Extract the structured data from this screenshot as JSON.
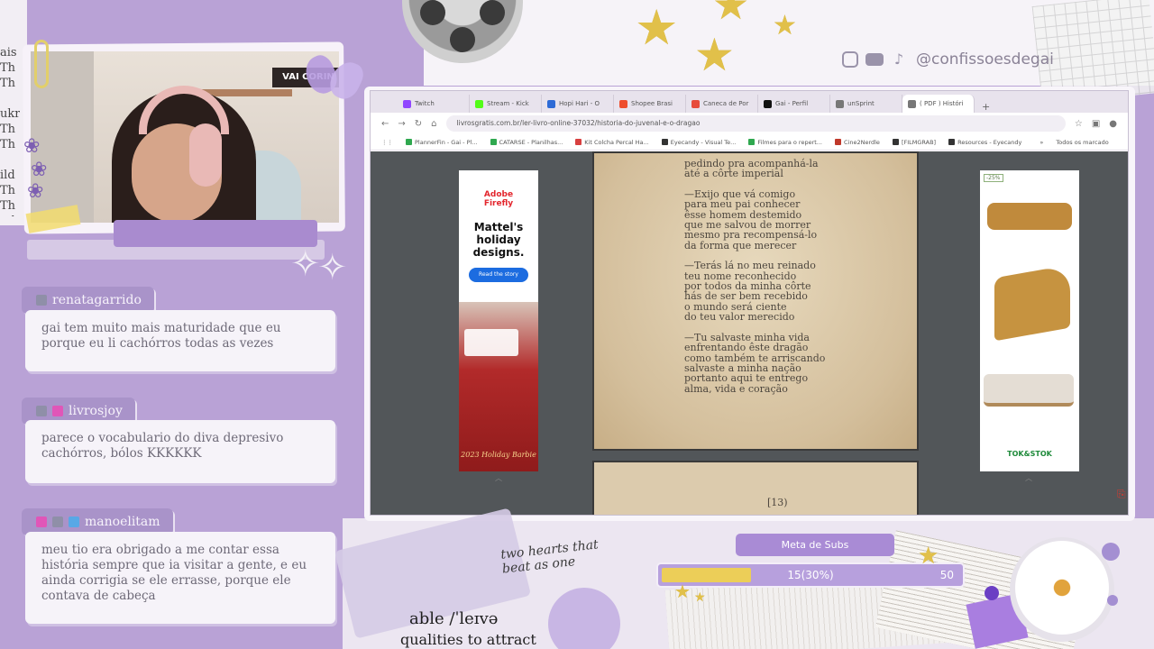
{
  "social": {
    "handle": "@confissoesdegai",
    "icons": [
      "instagram-icon",
      "youtube-icon",
      "tiktok-icon"
    ]
  },
  "webcam": {
    "sign_text": "VAI CORIN"
  },
  "left_news_text": "ais\nTh\nTh\n\nukr\nTh\nTh\n\nild\nTh\nTh\nnd",
  "chat": [
    {
      "user": "renatagarrido",
      "badges": [
        "gray"
      ],
      "message": "gai tem muito mais maturidade que eu porque eu li cachórros todas as vezes"
    },
    {
      "user": "livrosjoy",
      "badges": [
        "gray",
        "pink"
      ],
      "message": "parece o vocabulario do diva depresivo cachórros, bólos KKKKKK"
    },
    {
      "user": "manoelitam",
      "badges": [
        "pink",
        "gray",
        "blue"
      ],
      "message": "meu tio era obrigado a me contar essa história sempre que ia visitar a gente, e eu ainda corrigia se ele errasse, porque ele contava de cabeça"
    }
  ],
  "browser": {
    "tabs": [
      {
        "label": "Twitch",
        "color": "#9146ff"
      },
      {
        "label": "Stream - Kick",
        "color": "#53fc18"
      },
      {
        "label": "Hopi Hari - O",
        "color": "#2e6bd6"
      },
      {
        "label": "Shopee Brasi",
        "color": "#ee4d2d"
      },
      {
        "label": "Caneca de Por",
        "color": "#e74c3c"
      },
      {
        "label": "Gai - Perfil",
        "color": "#111111"
      },
      {
        "label": "unSprint",
        "color": "#777777"
      },
      {
        "label": "( PDF ) Históri",
        "color": "#777777"
      }
    ],
    "new_tab": "+",
    "url": "livrosgratis.com.br/ler-livro-online-37032/historia-do-juvenal-e-o-dragao",
    "bookmarks": [
      {
        "label": "PlannerFin - Gai - Pl...",
        "color": "#2fa84f"
      },
      {
        "label": "CATARSE - Planilhas...",
        "color": "#2fa84f"
      },
      {
        "label": "Kit Colcha Percal Ha...",
        "color": "#d84040"
      },
      {
        "label": "Eyecandy - Visual Te...",
        "color": "#333333"
      },
      {
        "label": "Filmes para o repert...",
        "color": "#2fa84f"
      },
      {
        "label": "Cine2Nerdle",
        "color": "#c0392b"
      },
      {
        "label": "[FILMGRAB]",
        "color": "#333333"
      },
      {
        "label": "Resources - Eyecandy",
        "color": "#333333"
      }
    ],
    "bookmarks_more": "»",
    "all_bookmarks": "Todos os marcado"
  },
  "ad_left": {
    "brand_line1": "Adobe",
    "brand_line2": "Firefly",
    "headline_1": "Mattel's",
    "headline_2": "holiday",
    "headline_3": "designs.",
    "cta": "Read the story",
    "caption": "2023 Holiday Barbie"
  },
  "ad_right": {
    "discount": "-25%",
    "logo": "TOK&STOK"
  },
  "pdf": {
    "paragraphs": [
      "pedindo pra acompanhá-la\naté a côrte imperial",
      "—Exijo que vá comigo\npara meu pai conhecer\nêsse homem destemido\nque me salvou de morrer\nmesmo pra recompensá-lo\nda forma que merecer",
      "—Terás lá no meu reinado\nteu nome reconhecido\npor todos da minha côrte\nhás de ser bem recebido\no mundo será ciente\ndo teu valor merecido",
      "—Tu salvaste minha vida\nenfrentando êste dragão\ncomo também te arriscando\nsalvaste a minha nação\nportanto aqui te entrego\nalma, vida e coração"
    ],
    "page_number": "[13)"
  },
  "sub_goal": {
    "label": "Meta de Subs",
    "progress_text": "15(30%)",
    "max": "50",
    "progress_fraction": 0.3,
    "fill_color": "#ecce58"
  },
  "collage": {
    "script_line1": "two hearts that",
    "script_line2": "beat as one",
    "dict_word": "able  /ˈleɪvə",
    "dict_line2": "qualities to attract"
  }
}
